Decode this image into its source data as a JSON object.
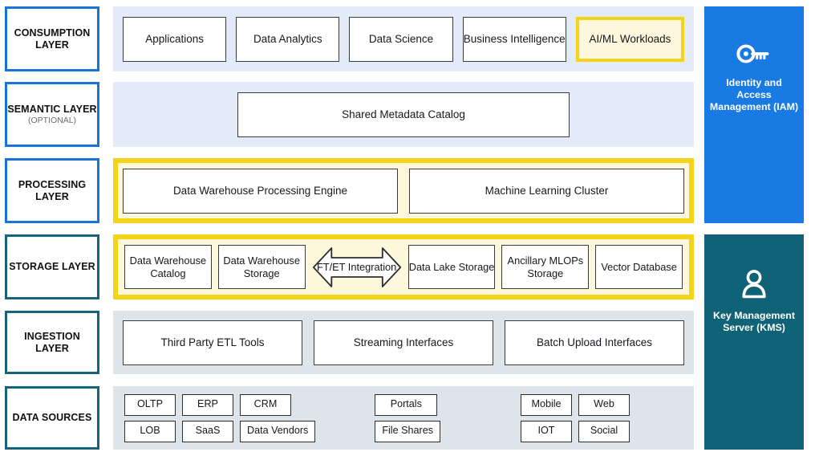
{
  "layers": [
    {
      "title": "CONSUMPTION LAYER",
      "sub": ""
    },
    {
      "title": "SEMANTIC LAYER",
      "sub": "(OPTIONAL)"
    },
    {
      "title": "PROCESSING LAYER",
      "sub": ""
    },
    {
      "title": "STORAGE LAYER",
      "sub": ""
    },
    {
      "title": "INGESTION LAYER",
      "sub": ""
    },
    {
      "title": "DATA SOURCES",
      "sub": ""
    }
  ],
  "consumption": {
    "nodes": [
      {
        "label": "Applications",
        "highlighted": false
      },
      {
        "label": "Data Analytics",
        "highlighted": false
      },
      {
        "label": "Data Science",
        "highlighted": false
      },
      {
        "label": "Business Intelligence",
        "highlighted": false
      },
      {
        "label": "AI/ML Workloads",
        "highlighted": true
      }
    ]
  },
  "semantic": {
    "nodes": [
      {
        "label": "Shared Metadata Catalog"
      }
    ]
  },
  "processing": {
    "nodes": [
      {
        "label": "Data Warehouse Processing Engine"
      },
      {
        "label": "Machine Learning Cluster"
      }
    ]
  },
  "storage": {
    "nodes": [
      {
        "label": "Data Warehouse Catalog",
        "type": "box"
      },
      {
        "label": "Data Warehouse Storage",
        "type": "box"
      },
      {
        "label": "FT/ET Integration",
        "type": "bidirectional-arrow"
      },
      {
        "label": "Data Lake Storage",
        "type": "box"
      },
      {
        "label": "Ancillary MLOPs Storage",
        "type": "box"
      },
      {
        "label": "Vector Database",
        "type": "box"
      }
    ]
  },
  "ingestion": {
    "nodes": [
      {
        "label": "Third Party ETL Tools"
      },
      {
        "label": "Streaming Interfaces"
      },
      {
        "label": "Batch Upload Interfaces"
      }
    ]
  },
  "data_sources": {
    "groups": [
      {
        "rows": [
          [
            "OLTP",
            "ERP",
            "CRM"
          ],
          [
            "LOB",
            "SaaS",
            "Data Vendors"
          ]
        ]
      },
      {
        "rows": [
          [
            "Portals"
          ],
          [
            "File Shares"
          ]
        ]
      },
      {
        "rows": [
          [
            "Mobile",
            "Web"
          ],
          [
            "IOT",
            "Social"
          ]
        ]
      }
    ]
  },
  "side_panels": [
    {
      "icon": "key-icon",
      "title": "Identity and Access Management (IAM)",
      "color": "#1a7ae4"
    },
    {
      "icon": "user-icon",
      "title": "Key Management Server (KMS)",
      "color": "#106277"
    }
  ],
  "colors": {
    "accent_blue": "#1a73d9",
    "accent_teal": "#15647c",
    "highlight_gold": "#f5d417",
    "band_blue": "#e4ebf8",
    "band_gray": "#dde4ea",
    "iam_blue": "#1a7ae4",
    "kms_teal": "#106277"
  }
}
